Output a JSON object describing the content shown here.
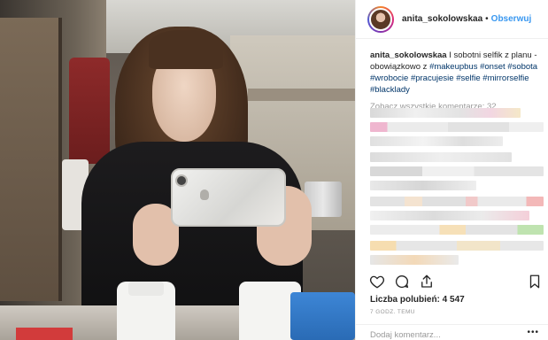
{
  "post": {
    "username": "anita_sokolowskaa",
    "follow_label": "Obserwuj",
    "separator": "•",
    "caption": {
      "username": "anita_sokolowskaa",
      "text": " I sobotni selfik z planu - obowiązkowo z ",
      "tags": [
        "#makeupbus",
        "#onset",
        "#sobota",
        "#wrobocie",
        "#pracujesie",
        "#selfie",
        "#mirrorselfie",
        "#blacklady"
      ]
    },
    "view_all_comments": "Zobacz wszystkie komentarze: 32",
    "likes_label": "Liczba polubień: 4 547",
    "time_label": "7 GODZ. TEMU",
    "add_comment_placeholder": "Dodaj komentarz...",
    "more_label": "•••"
  },
  "icons": {
    "heart": "heart-icon",
    "comment": "comment-icon",
    "share": "share-icon",
    "bookmark": "bookmark-icon"
  },
  "colors": {
    "follow_blue": "#3897f0",
    "hashtag": "#003569",
    "text": "#262626",
    "muted": "#999999",
    "border": "#efefef"
  }
}
